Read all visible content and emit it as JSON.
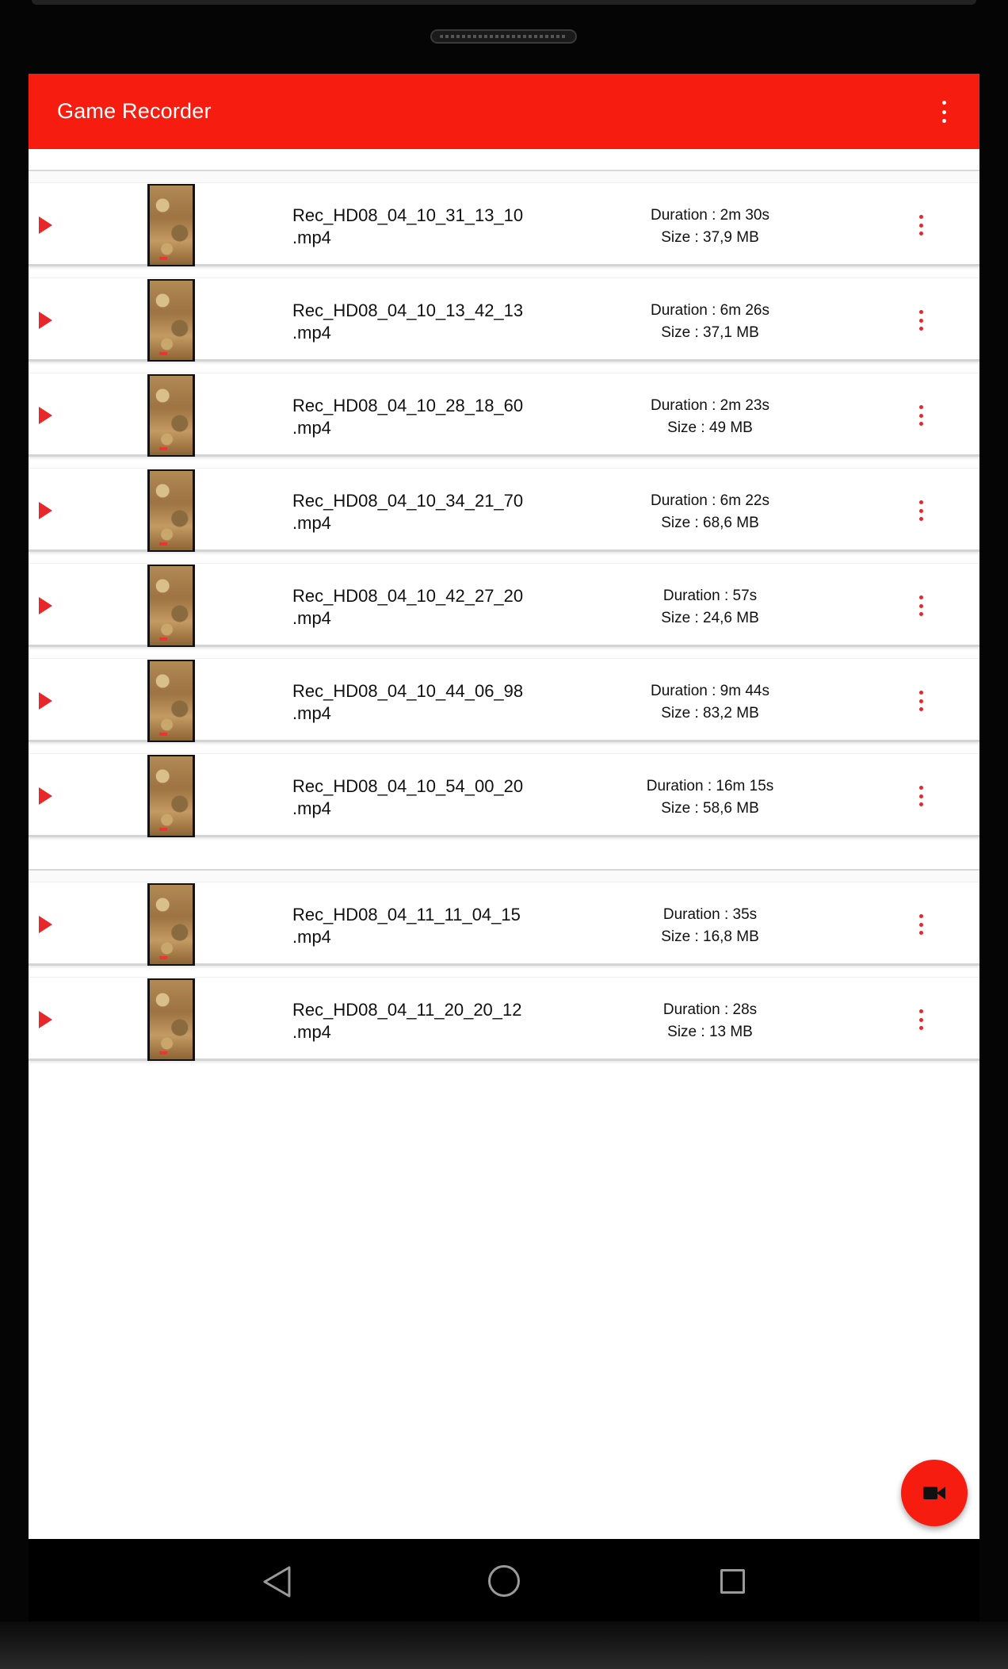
{
  "app": {
    "title": "Game Recorder",
    "accent_color": "#f61d10",
    "icon_color": "#e8272a"
  },
  "toolbar": {
    "overflow_icon": "more-vert-icon"
  },
  "groups": [
    {
      "items": [
        {
          "filename_line1": "Rec_HD08_04_10_31_13_10",
          "filename_line2": ".mp4",
          "duration": "Duration : 2m 30s",
          "size": "Size : 37,9 MB"
        },
        {
          "filename_line1": "Rec_HD08_04_10_13_42_13",
          "filename_line2": ".mp4",
          "duration": "Duration : 6m 26s",
          "size": "Size : 37,1 MB"
        },
        {
          "filename_line1": "Rec_HD08_04_10_28_18_60",
          "filename_line2": ".mp4",
          "duration": "Duration : 2m 23s",
          "size": "Size : 49 MB"
        },
        {
          "filename_line1": "Rec_HD08_04_10_34_21_70",
          "filename_line2": ".mp4",
          "duration": "Duration : 6m 22s",
          "size": "Size : 68,6 MB"
        },
        {
          "filename_line1": "Rec_HD08_04_10_42_27_20",
          "filename_line2": ".mp4",
          "duration": "Duration : 57s",
          "size": "Size : 24,6 MB"
        },
        {
          "filename_line1": "Rec_HD08_04_10_44_06_98",
          "filename_line2": ".mp4",
          "duration": "Duration : 9m 44s",
          "size": "Size : 83,2 MB"
        },
        {
          "filename_line1": "Rec_HD08_04_10_54_00_20",
          "filename_line2": ".mp4",
          "duration": "Duration : 16m 15s",
          "size": "Size : 58,6 MB"
        }
      ]
    },
    {
      "items": [
        {
          "filename_line1": "Rec_HD08_04_11_11_04_15",
          "filename_line2": ".mp4",
          "duration": "Duration : 35s",
          "size": "Size : 16,8 MB"
        },
        {
          "filename_line1": "Rec_HD08_04_11_20_20_12",
          "filename_line2": ".mp4",
          "duration": "Duration : 28s",
          "size": "Size : 13 MB"
        }
      ]
    }
  ],
  "fab": {
    "icon": "videocam-icon"
  },
  "navigation": {
    "back_icon": "back-triangle-icon",
    "home_icon": "home-circle-icon",
    "recents_icon": "recents-square-icon"
  }
}
